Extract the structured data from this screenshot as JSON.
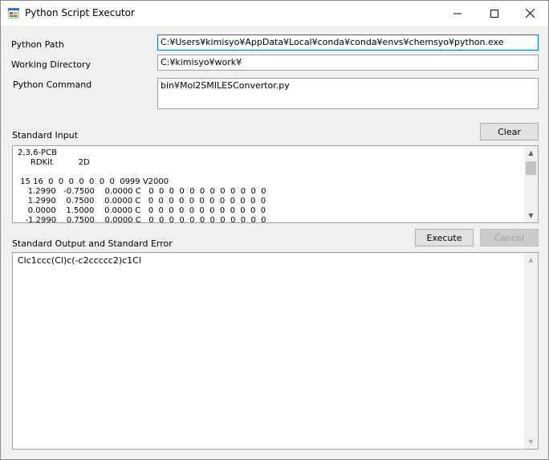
{
  "window": {
    "title": "Python Script Executor"
  },
  "labels": {
    "python_path": "Python Path",
    "working_directory": "Working Directory",
    "python_command": "Python Command",
    "standard_input": "Standard Input",
    "standard_output": "Standard Output and Standard Error"
  },
  "fields": {
    "python_path": "C:¥Users¥kimisyo¥AppData¥Local¥conda¥conda¥envs¥chemsyo¥python.exe",
    "working_directory": "C:¥kimisyo¥work¥",
    "python_command": "bin¥Mol2SMILESConvertor.py"
  },
  "buttons": {
    "clear": "Clear",
    "execute": "Execute",
    "cancel": "Cancel"
  },
  "standard_input_text": "2,3,6-PCB\n     RDKit          2D\n\n 15 16  0  0  0  0  0  0  0  0999 V2000\n    1.2990   -0.7500    0.0000 C   0  0  0  0  0  0  0  0  0  0  0  0\n    1.2990    0.7500    0.0000 C   0  0  0  0  0  0  0  0  0  0  0  0\n    0.0000    1.5000    0.0000 C   0  0  0  0  0  0  0  0  0  0  0  0\n   -1.2990    0.7500    0.0000 C   0  0  0  0  0  0  0  0  0  0  0  0",
  "standard_output_text": "Clc1ccc(Cl)c(-c2ccccc2)c1Cl"
}
